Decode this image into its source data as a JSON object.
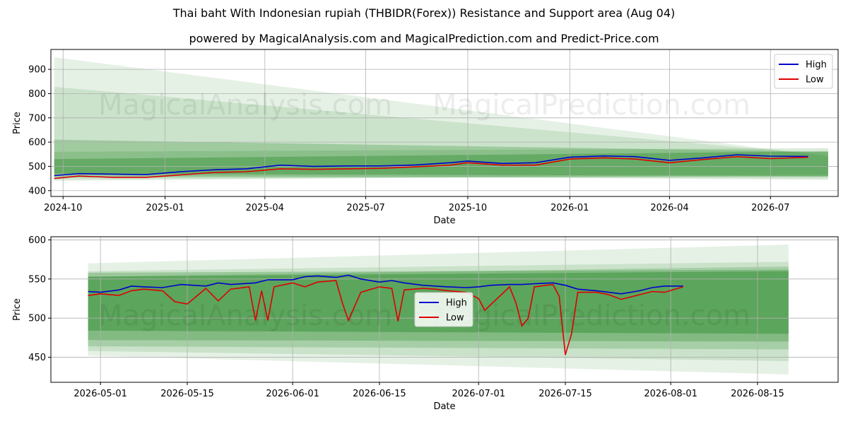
{
  "title": "Thai baht With Indonesian rupiah (THBIDR(Forex)) Resistance and Support area (Aug 04)",
  "subtitle": "powered by MagicalAnalysis.com and MagicalPrediction.com and Predict-Price.com",
  "watermark": [
    "MagicalAnalysis.com",
    "MagicalPrediction.com"
  ],
  "colors": {
    "high": "#0000cc",
    "low": "#dd0000",
    "band": "#2e8b2e",
    "grid": "#b0b0b0"
  },
  "chart_data": [
    {
      "type": "line",
      "xlabel": "Date",
      "ylabel": "Price",
      "x_range": [
        "2024-09-20",
        "2026-08-31"
      ],
      "ylim": [
        376,
        982
      ],
      "x_ticks": [
        "2024-10",
        "2025-01",
        "2025-04",
        "2025-07",
        "2025-10",
        "2026-01",
        "2026-04",
        "2026-07"
      ],
      "y_ticks": [
        400,
        500,
        600,
        700,
        800,
        900
      ],
      "grid": true,
      "legend": "top-right",
      "series": [
        {
          "name": "High",
          "x": [
            "2024-09-23",
            "2024-10-15",
            "2024-11-15",
            "2024-12-15",
            "2025-01-15",
            "2025-02-15",
            "2025-03-15",
            "2025-04-15",
            "2025-05-15",
            "2025-06-15",
            "2025-07-15",
            "2025-08-15",
            "2025-09-15",
            "2025-10-01",
            "2025-11-01",
            "2025-12-01",
            "2026-01-01",
            "2026-02-01",
            "2026-03-01",
            "2026-04-01",
            "2026-05-01",
            "2026-06-01",
            "2026-07-01",
            "2026-08-04"
          ],
          "values": [
            462,
            470,
            468,
            466,
            478,
            486,
            490,
            505,
            500,
            502,
            502,
            506,
            515,
            522,
            512,
            515,
            538,
            543,
            540,
            525,
            535,
            548,
            542,
            541
          ]
        },
        {
          "name": "Low",
          "x": [
            "2024-09-23",
            "2024-10-15",
            "2024-11-15",
            "2024-12-15",
            "2025-01-15",
            "2025-02-15",
            "2025-03-15",
            "2025-04-15",
            "2025-05-15",
            "2025-06-15",
            "2025-07-15",
            "2025-08-15",
            "2025-09-15",
            "2025-10-01",
            "2025-11-01",
            "2025-12-01",
            "2026-01-01",
            "2026-02-01",
            "2026-03-01",
            "2026-04-01",
            "2026-05-01",
            "2026-06-01",
            "2026-07-01",
            "2026-08-04"
          ],
          "values": [
            450,
            460,
            455,
            455,
            465,
            475,
            478,
            490,
            488,
            490,
            492,
            498,
            505,
            515,
            505,
            505,
            530,
            535,
            530,
            515,
            528,
            540,
            532,
            538
          ]
        }
      ],
      "bands": [
        {
          "x": [
            "2024-09-23",
            "2026-08-22"
          ],
          "upper": [
            950,
            540
          ],
          "lower": [
            440,
            468
          ],
          "opacity": 0.12
        },
        {
          "x": [
            "2024-09-23",
            "2026-08-22"
          ],
          "upper": [
            828,
            547
          ],
          "lower": [
            445,
            462
          ],
          "opacity": 0.14
        },
        {
          "x": [
            "2024-09-23",
            "2026-08-22"
          ],
          "upper": [
            610,
            560
          ],
          "lower": [
            455,
            455
          ],
          "opacity": 0.28
        },
        {
          "x": [
            "2024-09-23",
            "2026-08-22"
          ],
          "upper": [
            560,
            575
          ],
          "lower": [
            465,
            445
          ],
          "opacity": 0.18
        },
        {
          "x": [
            "2024-09-23",
            "2026-08-22"
          ],
          "upper": [
            530,
            562
          ],
          "lower": [
            470,
            460
          ],
          "opacity": 0.4
        }
      ]
    },
    {
      "type": "line",
      "xlabel": "Date",
      "ylabel": "Price",
      "x_range": [
        "2026-04-23",
        "2026-08-28"
      ],
      "ylim": [
        418,
        604
      ],
      "x_ticks": [
        "2026-05-01",
        "2026-05-15",
        "2026-06-01",
        "2026-06-15",
        "2026-07-01",
        "2026-07-15",
        "2026-08-01",
        "2026-08-15"
      ],
      "y_ticks": [
        450,
        500,
        550,
        600
      ],
      "grid": true,
      "legend": "center",
      "series": [
        {
          "name": "High",
          "x": [
            "2026-04-29",
            "2026-05-01",
            "2026-05-04",
            "2026-05-06",
            "2026-05-08",
            "2026-05-11",
            "2026-05-14",
            "2026-05-18",
            "2026-05-20",
            "2026-05-22",
            "2026-05-26",
            "2026-05-28",
            "2026-06-01",
            "2026-06-03",
            "2026-06-05",
            "2026-06-08",
            "2026-06-10",
            "2026-06-12",
            "2026-06-15",
            "2026-06-17",
            "2026-06-19",
            "2026-06-22",
            "2026-06-24",
            "2026-06-26",
            "2026-06-29",
            "2026-07-01",
            "2026-07-03",
            "2026-07-06",
            "2026-07-08",
            "2026-07-10",
            "2026-07-13",
            "2026-07-15",
            "2026-07-17",
            "2026-07-20",
            "2026-07-22",
            "2026-07-24",
            "2026-07-27",
            "2026-07-29",
            "2026-07-31",
            "2026-08-03"
          ],
          "values": [
            534,
            533,
            536,
            541,
            540,
            539,
            543,
            541,
            545,
            543,
            545,
            549,
            549,
            553,
            554,
            552,
            555,
            550,
            546,
            548,
            545,
            542,
            541,
            540,
            539,
            540,
            542,
            543,
            543,
            544,
            545,
            542,
            537,
            535,
            533,
            531,
            535,
            539,
            541,
            541
          ]
        },
        {
          "name": "Low",
          "x": [
            "2026-04-29",
            "2026-05-01",
            "2026-05-04",
            "2026-05-06",
            "2026-05-08",
            "2026-05-11",
            "2026-05-13",
            "2026-05-15",
            "2026-05-18",
            "2026-05-20",
            "2026-05-22",
            "2026-05-25",
            "2026-05-26",
            "2026-05-27",
            "2026-05-28",
            "2026-05-29",
            "2026-06-01",
            "2026-06-03",
            "2026-06-05",
            "2026-06-08",
            "2026-06-09",
            "2026-06-10",
            "2026-06-12",
            "2026-06-15",
            "2026-06-17",
            "2026-06-18",
            "2026-06-19",
            "2026-06-22",
            "2026-06-24",
            "2026-06-26",
            "2026-06-29",
            "2026-07-01",
            "2026-07-02",
            "2026-07-06",
            "2026-07-07",
            "2026-07-08",
            "2026-07-09",
            "2026-07-10",
            "2026-07-13",
            "2026-07-14",
            "2026-07-15",
            "2026-07-16",
            "2026-07-17",
            "2026-07-20",
            "2026-07-22",
            "2026-07-24",
            "2026-07-27",
            "2026-07-29",
            "2026-07-31",
            "2026-08-03"
          ],
          "values": [
            529,
            531,
            529,
            535,
            537,
            535,
            521,
            518,
            538,
            522,
            537,
            540,
            497,
            535,
            497,
            540,
            545,
            540,
            546,
            548,
            520,
            497,
            533,
            540,
            538,
            496,
            536,
            538,
            537,
            535,
            533,
            525,
            510,
            540,
            520,
            490,
            500,
            540,
            543,
            528,
            453,
            480,
            533,
            533,
            530,
            524,
            530,
            534,
            533,
            540
          ]
        }
      ],
      "bands": [
        {
          "x": [
            "2026-04-29",
            "2026-08-20"
          ],
          "upper": [
            570,
            594
          ],
          "lower": [
            452,
            428
          ],
          "opacity": 0.12
        },
        {
          "x": [
            "2026-04-29",
            "2026-08-20"
          ],
          "upper": [
            560,
            572
          ],
          "lower": [
            458,
            445
          ],
          "opacity": 0.15
        },
        {
          "x": [
            "2026-04-29",
            "2026-08-20"
          ],
          "upper": [
            553,
            566
          ],
          "lower": [
            464,
            460
          ],
          "opacity": 0.22
        },
        {
          "x": [
            "2026-04-29",
            "2026-08-20"
          ],
          "upper": [
            558,
            562
          ],
          "lower": [
            472,
            470
          ],
          "opacity": 0.3
        },
        {
          "x": [
            "2026-04-29",
            "2026-08-20"
          ],
          "upper": [
            553,
            560
          ],
          "lower": [
            484,
            480
          ],
          "opacity": 0.45
        }
      ]
    }
  ]
}
